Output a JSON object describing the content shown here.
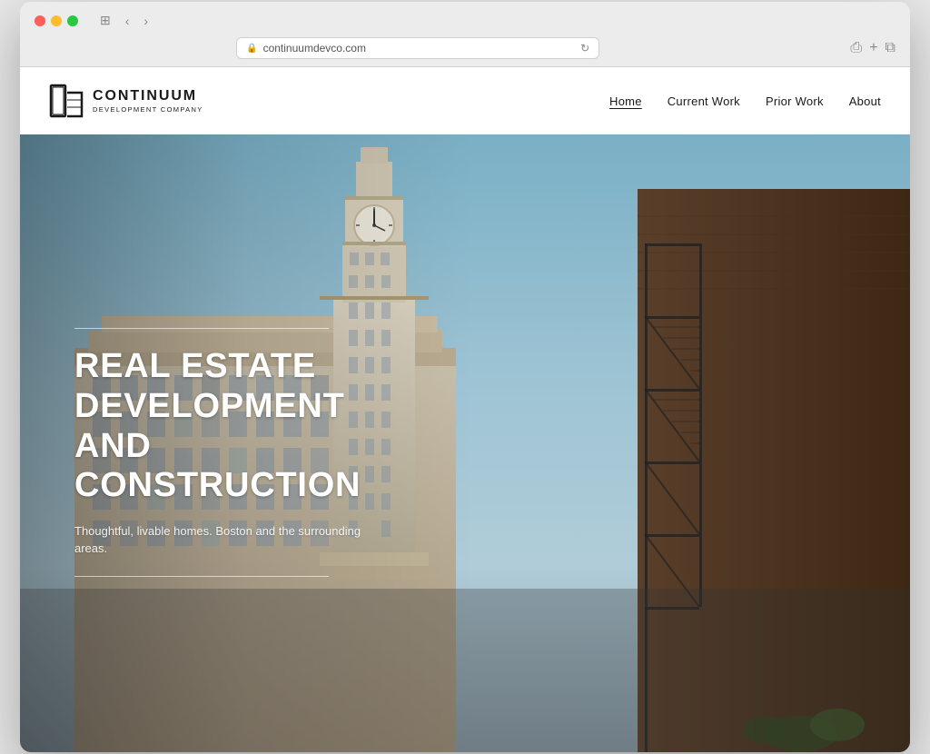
{
  "browser": {
    "url": "continuumdevco.com",
    "reload_label": "↻",
    "back_label": "‹",
    "forward_label": "›",
    "sidebar_label": "⊞"
  },
  "nav": {
    "logo_company": "CONTINUUM",
    "logo_subtitle": "DEVELOPMENT COMPANY",
    "links": [
      {
        "id": "home",
        "label": "Home",
        "active": true
      },
      {
        "id": "current-work",
        "label": "Current Work",
        "active": false
      },
      {
        "id": "prior-work",
        "label": "Prior Work",
        "active": false
      },
      {
        "id": "about",
        "label": "About",
        "active": false
      }
    ]
  },
  "hero": {
    "title_line1": "REAL ESTATE",
    "title_line2": "DEVELOPMENT",
    "title_line3": "AND CONSTRUCTION",
    "subtitle": "Thoughtful, livable homes. Boston and the surrounding areas."
  }
}
